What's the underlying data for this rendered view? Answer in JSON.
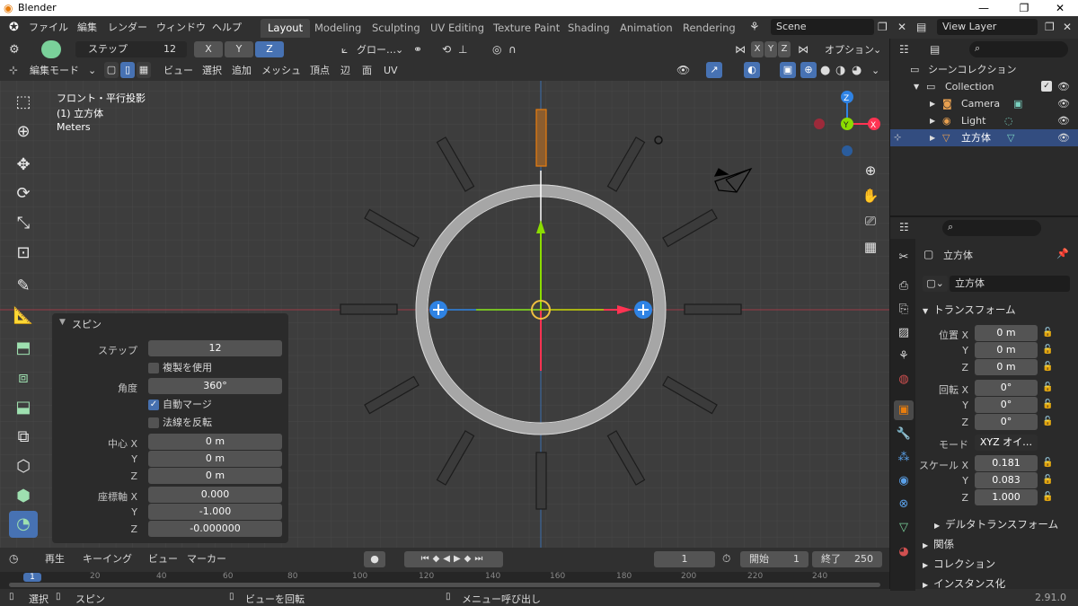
{
  "window": {
    "title": "Blender",
    "minimize": "—",
    "maximize": "❐",
    "close": "✕"
  },
  "menu": {
    "items": [
      "ファイル",
      "編集",
      "レンダー",
      "ウィンドウ",
      "ヘルプ"
    ]
  },
  "workspaces": [
    "Layout",
    "Modeling",
    "Sculpting",
    "UV Editing",
    "Texture Paint",
    "Shading",
    "Animation",
    "Rendering"
  ],
  "scene": {
    "name": "Scene",
    "view_layer": "View Layer"
  },
  "tool_header": {
    "steps_label": "ステップ",
    "steps_value": "12",
    "axis_x": "X",
    "axis_y": "Y",
    "axis_z": "Z",
    "orientation": "グロー…",
    "mirror_x": "X",
    "mirror_y": "Y",
    "mirror_z": "Z",
    "options": "オプション"
  },
  "viewport_header": {
    "mode": "編集モード",
    "menus": [
      "ビュー",
      "選択",
      "追加",
      "メッシュ",
      "頂点",
      "辺",
      "面",
      "UV"
    ]
  },
  "viewport_info": {
    "view": "フロント・平行投影",
    "object": "(1) 立方体",
    "units": "Meters"
  },
  "gizmo": {
    "x": "X",
    "y": "Y",
    "z": "Z"
  },
  "operator": {
    "title": "スピン",
    "steps_label": "ステップ",
    "steps_value": "12",
    "dupli_label": "複製を使用",
    "dupli_on": false,
    "angle_label": "角度",
    "angle_value": "360°",
    "automerge_label": "自動マージ",
    "automerge_on": true,
    "flip_label": "法線を反転",
    "flip_on": false,
    "center_x_label": "中心 X",
    "center_x": "0 m",
    "center_y_label": "Y",
    "center_y": "0 m",
    "center_z_label": "Z",
    "center_z": "0 m",
    "axis_x_label": "座標軸 X",
    "axis_x": "0.000",
    "axis_y_label": "Y",
    "axis_y": "-1.000",
    "axis_z_label": "Z",
    "axis_z": "-0.000000"
  },
  "timeline": {
    "menus": [
      "再生",
      "キーイング",
      "ビュー",
      "マーカー"
    ],
    "current_frame": "1",
    "start_label": "開始",
    "start": "1",
    "end_label": "終了",
    "end": "250",
    "ruler": [
      "1",
      "20",
      "40",
      "60",
      "80",
      "100",
      "120",
      "140",
      "160",
      "180",
      "200",
      "220",
      "240"
    ]
  },
  "statusbar": {
    "select": "選択",
    "spin": "スピン",
    "rotate_view": "ビューを回転",
    "call_menu": "メニュー呼び出し",
    "version": "2.91.0"
  },
  "outliner": {
    "scene_collection": "シーンコレクション",
    "collection": "Collection",
    "items": [
      "Camera",
      "Light",
      "立方体"
    ]
  },
  "properties": {
    "object_name": "立方体",
    "data_name": "立方体",
    "transform_title": "トランスフォーム",
    "loc_x_label": "位置 X",
    "loc_x": "0 m",
    "loc_y_label": "Y",
    "loc_y": "0 m",
    "loc_z_label": "Z",
    "loc_z": "0 m",
    "rot_x_label": "回転 X",
    "rot_x": "0°",
    "rot_y_label": "Y",
    "rot_y": "0°",
    "rot_z_label": "Z",
    "rot_z": "0°",
    "mode_label": "モード",
    "mode_value": "XYZ オイ…",
    "scale_x_label": "スケール X",
    "scale_x": "0.181",
    "scale_y_label": "Y",
    "scale_y": "0.083",
    "scale_z_label": "Z",
    "scale_z": "1.000",
    "delta_title": "デルタトランスフォーム",
    "relations_title": "関係",
    "collections_title": "コレクション",
    "instancing_title": "インスタンス化"
  },
  "colors": {
    "accent": "#4772b3",
    "axis_x": "#ff3352",
    "axis_y": "#8bdc00",
    "axis_z": "#2f83e4",
    "selected_face": "#e87d0d"
  }
}
